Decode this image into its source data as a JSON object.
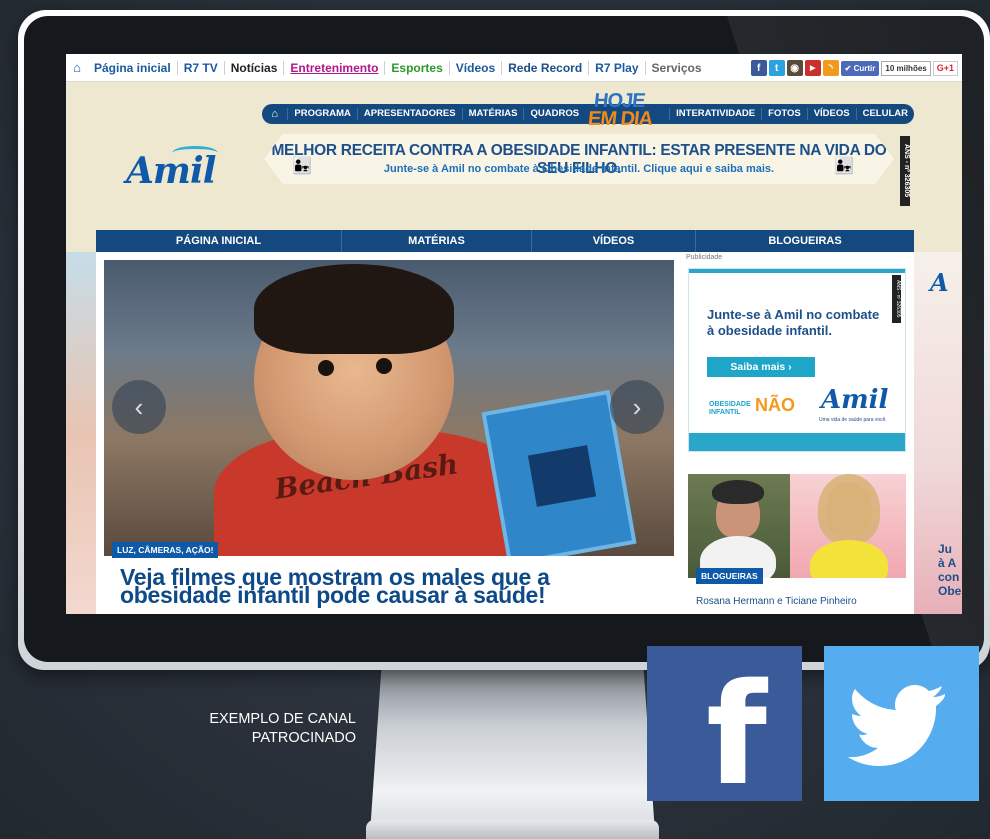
{
  "r7nav": {
    "items": [
      "Página inicial",
      "R7 TV",
      "Notícias",
      "Entretenimento",
      "Esportes",
      "Vídeos",
      "Rede Record",
      "R7 Play",
      "Serviços"
    ],
    "curtir": "Curtir",
    "likes": "10 milhões",
    "gplus": "G+1"
  },
  "program_bar": {
    "left_items": [
      "PROGRAMA",
      "APRESENTADORES",
      "MATÉRIAS",
      "QUADROS"
    ],
    "right_items": [
      "INTERATIVIDADE",
      "FOTOS",
      "VÍDEOS",
      "CELULAR"
    ],
    "logo_line1": "HOJE",
    "logo_line2": "EM DIA"
  },
  "sponsor": {
    "logo": "Amil",
    "banner_headline": "MELHOR RECEITA CONTRA A OBESIDADE INFANTIL: ESTAR PRESENTE NA VIDA DO SEU FILHO.",
    "banner_sub": "Junte-se à Amil no combate à Obesidade Infantil. Clique aqui e saiba mais.",
    "ans": "ANS - nº 326305"
  },
  "main_nav": [
    "PÁGINA INICIAL",
    "MATÉRIAS",
    "VÍDEOS",
    "BLOGUEIRAS"
  ],
  "featured": {
    "tag": "LUZ, CÂMERAS, AÇÃO!",
    "headline": "Veja filmes que mostram os males que a obesidade infantil pode causar à saúde!",
    "shirt_text": "Beach Bash",
    "prev_icon": "chevron-left-icon",
    "next_icon": "chevron-right-icon"
  },
  "ad": {
    "label": "Publicidade",
    "headline": "Junte-se à Amil no combate à obesidade infantil.",
    "button": "Saiba mais ›",
    "ob_label": "OBESIDADE\nINFANTIL",
    "nao": "NÃO",
    "logo": "Amil",
    "tagline": "Uma vida de saúde para você.",
    "ans": "ANS - nº 326305"
  },
  "bloggers": {
    "tag": "BLOGUEIRAS",
    "names": "Rosana Hermann e Ticiane Pinheiro"
  },
  "right_edge": {
    "logo_fragment": "A",
    "text_fragment": "Ju\nà A\ncon\nObe"
  },
  "caption": "EXEMPLO DE CANAL PATROCINADO",
  "social_tiles": [
    "facebook",
    "twitter"
  ],
  "colors": {
    "brand_blue": "#14497f",
    "amil_blue": "#0f5aa8",
    "facebook": "#3b5a9a",
    "twitter": "#55acee",
    "accent_orange": "#f29a1c"
  }
}
